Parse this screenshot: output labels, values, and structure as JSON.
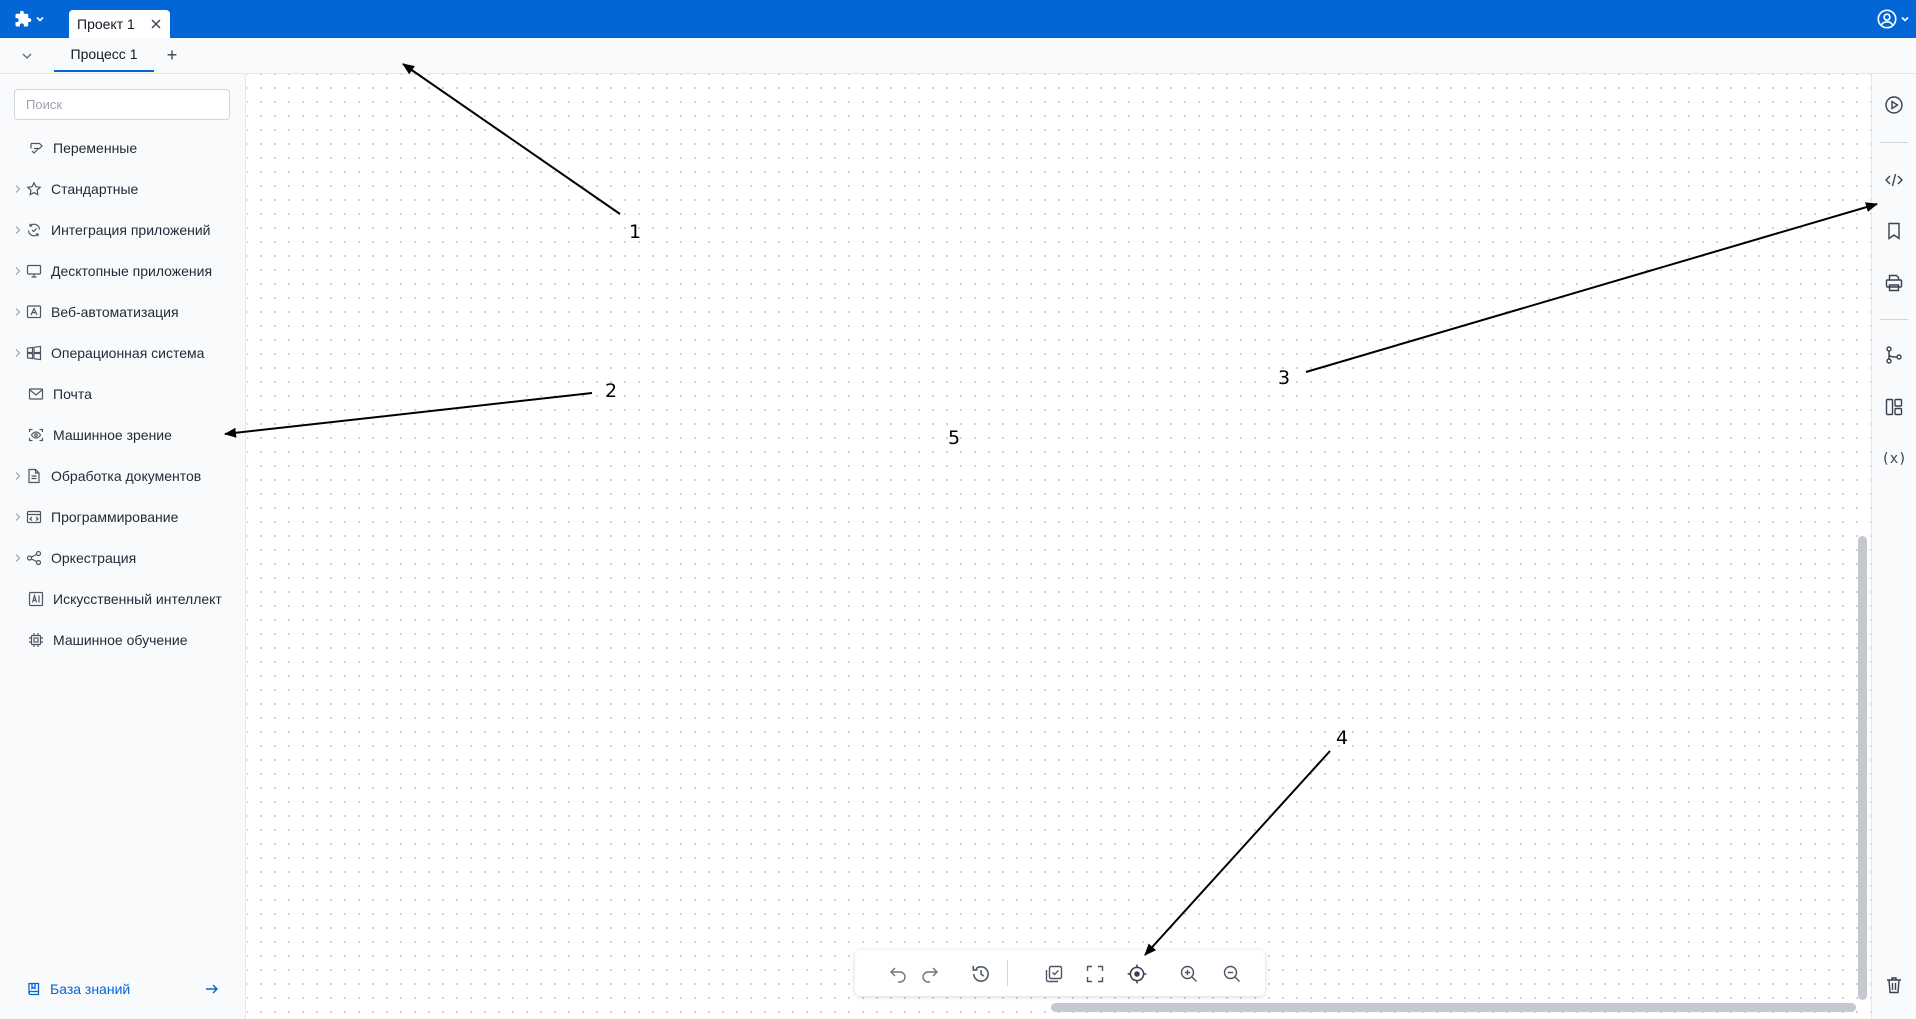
{
  "topbar": {
    "project_tab_label": "Проект 1"
  },
  "subbar": {
    "process_tab_label": "Процесс 1",
    "add_tab_label": "+"
  },
  "sidebar": {
    "search_placeholder": "Поиск",
    "categories": [
      {
        "label": "Переменные",
        "icon": "variables-icon",
        "expandable": false
      },
      {
        "label": "Стандартные",
        "icon": "star-icon",
        "expandable": true
      },
      {
        "label": "Интеграция приложений",
        "icon": "integration-icon",
        "expandable": true
      },
      {
        "label": "Десктопные приложения",
        "icon": "monitor-icon",
        "expandable": true
      },
      {
        "label": "Веб-автоматизация",
        "icon": "web-automation-icon",
        "expandable": true
      },
      {
        "label": "Операционная система",
        "icon": "windows-icon",
        "expandable": true
      },
      {
        "label": "Почта",
        "icon": "mail-icon",
        "expandable": false
      },
      {
        "label": "Машинное зрение",
        "icon": "scan-eye-icon",
        "expandable": false
      },
      {
        "label": "Обработка документов",
        "icon": "document-icon",
        "expandable": true
      },
      {
        "label": "Программирование",
        "icon": "code-window-icon",
        "expandable": true
      },
      {
        "label": "Оркестрация",
        "icon": "share-nodes-icon",
        "expandable": true
      },
      {
        "label": "Искусственный интеллект",
        "icon": "ai-icon",
        "expandable": false
      },
      {
        "label": "Машинное обучение",
        "icon": "chip-icon",
        "expandable": false
      }
    ],
    "knowledge_base_label": "База знаний"
  },
  "right_panel": {
    "variables_label": "(x)"
  },
  "annotations": {
    "a1": "1",
    "a2": "2",
    "a3": "3",
    "a4": "4",
    "a5": "5"
  },
  "colors": {
    "topbar": "#0366d6",
    "accent": "#0366d6",
    "sidebar_bg": "#f9fafb",
    "canvas_dot": "#c9ced6"
  }
}
